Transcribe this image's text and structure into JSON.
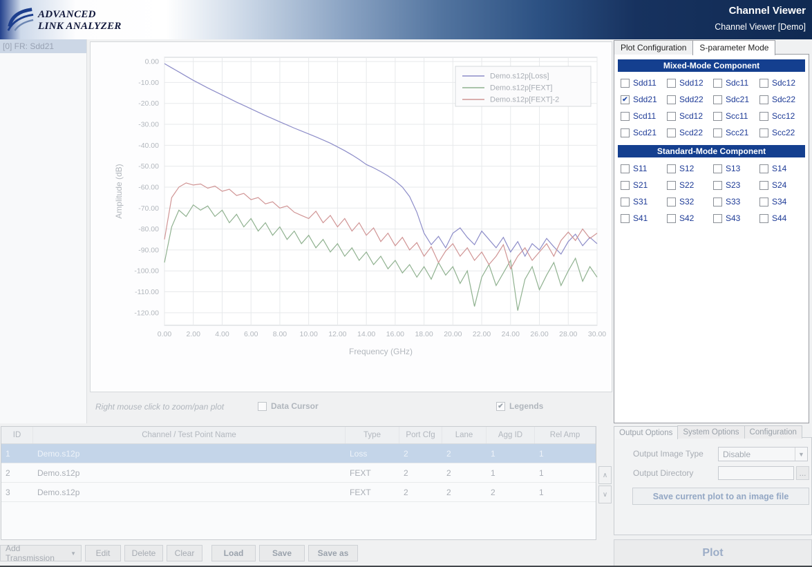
{
  "header": {
    "logo_line1": "ADVANCED",
    "logo_line2": "LINK ANALYZER",
    "title": "Channel Viewer",
    "subtitle": "Channel Viewer [Demo]"
  },
  "icons": {
    "check": "✔",
    "dropdown_arrow": "▼",
    "combo_arrow": "▼"
  },
  "sidebar": {
    "items": [
      {
        "label": "[0] FR: Sdd21",
        "selected": true
      }
    ]
  },
  "plot_panel": {
    "hint": "Right mouse click to zoom/pan plot",
    "data_cursor_label": "Data Cursor",
    "data_cursor_checked": false,
    "legends_label": "Legends",
    "legends_checked": true
  },
  "chart_data": {
    "type": "line",
    "title": "",
    "xlabel": "Frequency (GHz)",
    "ylabel": "Amplitude (dB)",
    "xlim": [
      0,
      30
    ],
    "ylim": [
      -126,
      2
    ],
    "xticks": [
      0,
      2,
      4,
      6,
      8,
      10,
      12,
      14,
      16,
      18,
      20,
      22,
      24,
      26,
      28,
      30
    ],
    "yticks": [
      0,
      -10,
      -20,
      -30,
      -40,
      -50,
      -60,
      -70,
      -80,
      -90,
      -100,
      -110,
      -120
    ],
    "grid": true,
    "legend_position": "top-right",
    "series": [
      {
        "name": "Demo.s12p[Loss]",
        "color": "#8c8cc8",
        "points": [
          [
            0,
            -1
          ],
          [
            0.5,
            -3
          ],
          [
            1,
            -5
          ],
          [
            1.5,
            -7
          ],
          [
            2,
            -9
          ],
          [
            2.5,
            -10.8
          ],
          [
            3,
            -12.6
          ],
          [
            3.5,
            -14.3
          ],
          [
            4,
            -16
          ],
          [
            4.5,
            -17.7
          ],
          [
            5,
            -19.4
          ],
          [
            5.5,
            -21
          ],
          [
            6,
            -22.6
          ],
          [
            6.5,
            -24.2
          ],
          [
            7,
            -25.8
          ],
          [
            7.5,
            -27.3
          ],
          [
            8,
            -28.8
          ],
          [
            8.5,
            -30.3
          ],
          [
            9,
            -31.8
          ],
          [
            9.5,
            -33.2
          ],
          [
            10,
            -34.6
          ],
          [
            10.5,
            -36
          ],
          [
            11,
            -37.5
          ],
          [
            11.5,
            -39
          ],
          [
            12,
            -40.8
          ],
          [
            12.5,
            -42.6
          ],
          [
            13,
            -44.6
          ],
          [
            13.5,
            -46.8
          ],
          [
            14,
            -49.2
          ],
          [
            14.5,
            -50.8
          ],
          [
            15,
            -52.6
          ],
          [
            15.5,
            -54.6
          ],
          [
            16,
            -57
          ],
          [
            16.5,
            -60
          ],
          [
            17,
            -64.5
          ],
          [
            17.5,
            -72
          ],
          [
            18,
            -82
          ],
          [
            18.5,
            -87.5
          ],
          [
            19,
            -83.5
          ],
          [
            19.5,
            -89
          ],
          [
            20,
            -82
          ],
          [
            20.5,
            -79.5
          ],
          [
            21,
            -84
          ],
          [
            21.5,
            -87.5
          ],
          [
            22,
            -81
          ],
          [
            22.5,
            -85
          ],
          [
            23,
            -89
          ],
          [
            23.5,
            -84
          ],
          [
            24,
            -91
          ],
          [
            24.5,
            -86
          ],
          [
            25,
            -93
          ],
          [
            25.5,
            -87
          ],
          [
            26,
            -90
          ],
          [
            26.5,
            -84.5
          ],
          [
            27,
            -88.5
          ],
          [
            27.5,
            -92
          ],
          [
            28,
            -86
          ],
          [
            28.5,
            -82.5
          ],
          [
            29,
            -88
          ],
          [
            29.5,
            -84
          ],
          [
            30,
            -87
          ]
        ]
      },
      {
        "name": "Demo.s12p[FEXT]",
        "color": "#8fb18f",
        "points": [
          [
            0,
            -96
          ],
          [
            0.5,
            -79
          ],
          [
            1,
            -71
          ],
          [
            1.5,
            -74
          ],
          [
            2,
            -68.5
          ],
          [
            2.5,
            -71
          ],
          [
            3,
            -69
          ],
          [
            3.5,
            -74
          ],
          [
            4,
            -71
          ],
          [
            4.5,
            -77
          ],
          [
            5,
            -73
          ],
          [
            5.5,
            -79
          ],
          [
            6,
            -75
          ],
          [
            6.5,
            -81
          ],
          [
            7,
            -77
          ],
          [
            7.5,
            -83
          ],
          [
            8,
            -79
          ],
          [
            8.5,
            -85
          ],
          [
            9,
            -81
          ],
          [
            9.5,
            -87
          ],
          [
            10,
            -83
          ],
          [
            10.5,
            -89
          ],
          [
            11,
            -85
          ],
          [
            11.5,
            -91
          ],
          [
            12,
            -87
          ],
          [
            12.5,
            -93
          ],
          [
            13,
            -89
          ],
          [
            13.5,
            -95
          ],
          [
            14,
            -91
          ],
          [
            14.5,
            -97
          ],
          [
            15,
            -93
          ],
          [
            15.5,
            -99
          ],
          [
            16,
            -95
          ],
          [
            16.5,
            -101
          ],
          [
            17,
            -97
          ],
          [
            17.5,
            -103
          ],
          [
            18,
            -98
          ],
          [
            18.5,
            -104
          ],
          [
            19,
            -96
          ],
          [
            19.5,
            -102
          ],
          [
            20,
            -98
          ],
          [
            20.5,
            -106
          ],
          [
            21,
            -100
          ],
          [
            21.5,
            -117
          ],
          [
            22,
            -103
          ],
          [
            22.5,
            -97
          ],
          [
            23,
            -107
          ],
          [
            23.5,
            -101
          ],
          [
            24,
            -95
          ],
          [
            24.5,
            -119
          ],
          [
            25,
            -104
          ],
          [
            25.5,
            -98
          ],
          [
            26,
            -109
          ],
          [
            26.5,
            -102
          ],
          [
            27,
            -96
          ],
          [
            27.5,
            -107
          ],
          [
            28,
            -100
          ],
          [
            28.5,
            -94
          ],
          [
            29,
            -105
          ],
          [
            29.5,
            -98
          ],
          [
            30,
            -103
          ]
        ]
      },
      {
        "name": "Demo.s12p[FEXT]-2",
        "color": "#d09494",
        "points": [
          [
            0,
            -85
          ],
          [
            0.5,
            -65
          ],
          [
            1,
            -60
          ],
          [
            1.5,
            -58
          ],
          [
            2,
            -59
          ],
          [
            2.5,
            -58.5
          ],
          [
            3,
            -60.5
          ],
          [
            3.5,
            -59.5
          ],
          [
            4,
            -62
          ],
          [
            4.5,
            -61
          ],
          [
            5,
            -64
          ],
          [
            5.5,
            -63
          ],
          [
            6,
            -66
          ],
          [
            6.5,
            -65
          ],
          [
            7,
            -68
          ],
          [
            7.5,
            -67
          ],
          [
            8,
            -70
          ],
          [
            8.5,
            -69
          ],
          [
            9,
            -72
          ],
          [
            9.5,
            -73.5
          ],
          [
            10,
            -75
          ],
          [
            10.5,
            -71.5
          ],
          [
            11,
            -77
          ],
          [
            11.5,
            -73.5
          ],
          [
            12,
            -79
          ],
          [
            12.5,
            -75
          ],
          [
            13,
            -81
          ],
          [
            13.5,
            -77
          ],
          [
            14,
            -83
          ],
          [
            14.5,
            -79.5
          ],
          [
            15,
            -86
          ],
          [
            15.5,
            -82
          ],
          [
            16,
            -88
          ],
          [
            16.5,
            -84
          ],
          [
            17,
            -90
          ],
          [
            17.5,
            -86.5
          ],
          [
            18,
            -93
          ],
          [
            18.5,
            -88.5
          ],
          [
            19,
            -96
          ],
          [
            19.5,
            -90.5
          ],
          [
            20,
            -87
          ],
          [
            20.5,
            -93
          ],
          [
            21,
            -89
          ],
          [
            21.5,
            -95
          ],
          [
            22,
            -91
          ],
          [
            22.5,
            -97
          ],
          [
            23,
            -93
          ],
          [
            23.5,
            -87.5
          ],
          [
            24,
            -99
          ],
          [
            24.5,
            -93
          ],
          [
            25,
            -89
          ],
          [
            25.5,
            -95
          ],
          [
            26,
            -91
          ],
          [
            26.5,
            -87
          ],
          [
            27,
            -93
          ],
          [
            27.5,
            -85.5
          ],
          [
            28,
            -81.5
          ],
          [
            28.5,
            -85.5
          ],
          [
            29,
            -80
          ],
          [
            29.5,
            -84.5
          ],
          [
            30,
            -82
          ]
        ]
      }
    ]
  },
  "sparam_panel": {
    "tabs": [
      {
        "label": "Plot Configuration",
        "active": false
      },
      {
        "label": "S-parameter Mode",
        "active": true
      }
    ],
    "mixed_header": "Mixed-Mode Component",
    "mixed": [
      {
        "label": "Sdd11",
        "checked": false
      },
      {
        "label": "Sdd12",
        "checked": false
      },
      {
        "label": "Sdc11",
        "checked": false
      },
      {
        "label": "Sdc12",
        "checked": false
      },
      {
        "label": "Sdd21",
        "checked": true
      },
      {
        "label": "Sdd22",
        "checked": false
      },
      {
        "label": "Sdc21",
        "checked": false
      },
      {
        "label": "Sdc22",
        "checked": false
      },
      {
        "label": "Scd11",
        "checked": false
      },
      {
        "label": "Scd12",
        "checked": false
      },
      {
        "label": "Scc11",
        "checked": false
      },
      {
        "label": "Scc12",
        "checked": false
      },
      {
        "label": "Scd21",
        "checked": false
      },
      {
        "label": "Scd22",
        "checked": false
      },
      {
        "label": "Scc21",
        "checked": false
      },
      {
        "label": "Scc22",
        "checked": false
      }
    ],
    "standard_header": "Standard-Mode Component",
    "standard": [
      {
        "label": "S11",
        "checked": false
      },
      {
        "label": "S12",
        "checked": false
      },
      {
        "label": "S13",
        "checked": false
      },
      {
        "label": "S14",
        "checked": false
      },
      {
        "label": "S21",
        "checked": false
      },
      {
        "label": "S22",
        "checked": false
      },
      {
        "label": "S23",
        "checked": false
      },
      {
        "label": "S24",
        "checked": false
      },
      {
        "label": "S31",
        "checked": false
      },
      {
        "label": "S32",
        "checked": false
      },
      {
        "label": "S33",
        "checked": false
      },
      {
        "label": "S34",
        "checked": false
      },
      {
        "label": "S41",
        "checked": false
      },
      {
        "label": "S42",
        "checked": false
      },
      {
        "label": "S43",
        "checked": false
      },
      {
        "label": "S44",
        "checked": false
      }
    ]
  },
  "table": {
    "columns": [
      "ID",
      "Channel / Test Point Name",
      "Type",
      "Port Cfg",
      "Lane",
      "Agg ID",
      "Rel Amp"
    ],
    "rows": [
      {
        "id": "1",
        "name": "Demo.s12p",
        "type": "Loss",
        "port_cfg": "2",
        "lane": "2",
        "agg_id": "1",
        "rel_amp": "1",
        "selected": true
      },
      {
        "id": "2",
        "name": "Demo.s12p",
        "type": "FEXT",
        "port_cfg": "2",
        "lane": "2",
        "agg_id": "1",
        "rel_amp": "1",
        "selected": false
      },
      {
        "id": "3",
        "name": "Demo.s12p",
        "type": "FEXT",
        "port_cfg": "2",
        "lane": "2",
        "agg_id": "2",
        "rel_amp": "1",
        "selected": false
      }
    ],
    "up_label": "∧",
    "down_label": "∨"
  },
  "toolbar": {
    "add_transmission": "Add Transmission",
    "edit": "Edit",
    "delete": "Delete",
    "clear": "Clear",
    "load": "Load",
    "save": "Save",
    "save_as": "Save as"
  },
  "output_panel": {
    "tabs": [
      {
        "label": "Output Options",
        "active": true
      },
      {
        "label": "System Options",
        "active": false
      },
      {
        "label": "Configuration",
        "active": false
      }
    ],
    "output_image_type_label": "Output Image Type",
    "output_image_type_value": "Disable",
    "output_directory_label": "Output Directory",
    "output_directory_value": "",
    "browse_label": "...",
    "save_plot_button": "Save current plot to an image file",
    "plot_button": "Plot"
  }
}
